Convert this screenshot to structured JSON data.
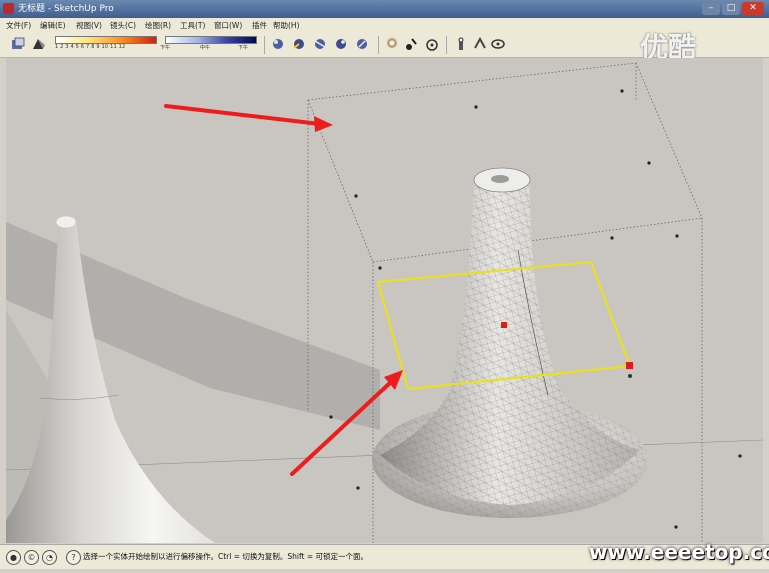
{
  "window": {
    "title": "无标题 - SketchUp Pro"
  },
  "menu": [
    "文件(F)",
    "编辑(E)",
    "视图(V)",
    "镜头(C)",
    "绘图(R)",
    "工具(T)",
    "窗口(W)",
    "插件",
    "帮助(H)"
  ],
  "toolbar": {
    "shadow_scale_ticks": "1 2 3 4 5 6 7 8 9 10 11 12",
    "time_min": "下午",
    "time_mid": "中午",
    "time_max": "下午"
  },
  "status": {
    "text": "选择一个实体开始绘制以进行偏移操作。Ctrl = 切换为复制。Shift = 可锁定一个面。"
  },
  "watermarks": {
    "top": "优酷",
    "bottom": "www.eeeetop.com"
  },
  "colors": {
    "selection": "#e8e020",
    "arrow": "#ee1c1c",
    "grip": "#dd1c1c"
  }
}
